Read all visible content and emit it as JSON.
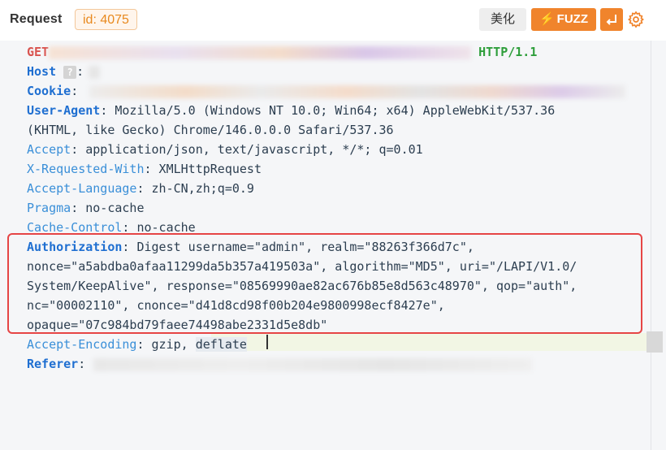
{
  "header": {
    "title": "Request",
    "id_tag": "id: 4075",
    "beautify_label": "美化",
    "fuzz_label": "FUZZ"
  },
  "request": {
    "method": "GET",
    "protocol": "HTTP/1.1",
    "host_key": "Host",
    "host_help": "?",
    "cookie_key": "Cookie",
    "ua_key": "User-Agent",
    "ua_line1": " Mozilla/5.0 (Windows NT 10.0; Win64; x64) AppleWebKit/537.36",
    "ua_line2": "(KHTML, like Gecko) Chrome/146.0.0.0 Safari/537.36",
    "accept_key": "Accept",
    "accept_val": " application/json, text/javascript, */*; q=0.01",
    "xrw_key": "X-Requested-With",
    "xrw_val": " XMLHttpRequest",
    "al_key": "Accept-Language",
    "al_val": " zh-CN,zh;q=0.9",
    "pragma_key": "Pragma",
    "pragma_val": " no-cache",
    "cc_key": "Cache-Control",
    "cc_val": " no-cache",
    "auth_key": "Authorization",
    "auth_line1": " Digest username=\"admin\", realm=\"88263f366d7c\",",
    "auth_line2": "nonce=\"a5abdba0afaa11299da5b357a419503a\", algorithm=\"MD5\", uri=\"/LAPI/V1.0/",
    "auth_line3": "System/KeepAlive\", response=\"08569990ae82ac676b85e8d563c48970\", qop=\"auth\",",
    "auth_line4": "nc=\"00002110\", cnonce=\"d41d8cd98f00b204e9800998ecf8427e\",",
    "auth_line5": "opaque=\"07c984bd79faee74498abe2331d5e8db\"",
    "ae_key": "Accept-Encoding",
    "ae_val_a": " gzip, ",
    "ae_val_b": "deflate",
    "referer_key": "Referer"
  },
  "colors": {
    "accent": "#f0842c",
    "highlight_border": "#e64545",
    "key_blue": "#1f6fd1"
  }
}
